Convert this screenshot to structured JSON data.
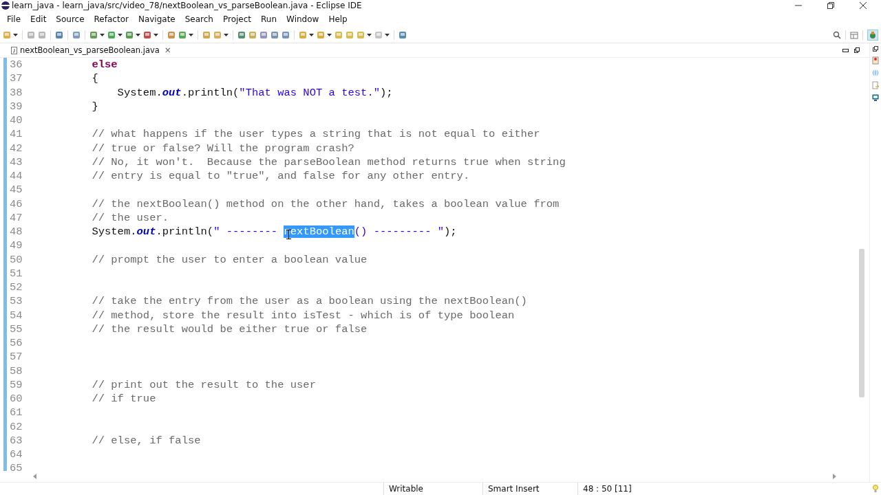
{
  "window": {
    "title": "learn_java - learn_java/src/video_78/nextBoolean_vs_parseBoolean.java - Eclipse IDE"
  },
  "menu": [
    "File",
    "Edit",
    "Source",
    "Refactor",
    "Navigate",
    "Search",
    "Project",
    "Run",
    "Window",
    "Help"
  ],
  "editor_tab": {
    "label": "nextBoolean_vs_parseBoolean.java",
    "close": "×"
  },
  "lines": [
    {
      "num": "36",
      "tokens": [
        {
          "kind": "keyword",
          "text": "        else"
        }
      ]
    },
    {
      "num": "37",
      "tokens": [
        {
          "kind": "plain",
          "text": "        {"
        }
      ]
    },
    {
      "num": "38",
      "tokens": [
        {
          "kind": "plain",
          "text": "            System."
        },
        {
          "kind": "field",
          "text": "out"
        },
        {
          "kind": "plain",
          "text": ".println("
        },
        {
          "kind": "string",
          "text": "\"That was NOT a test.\""
        },
        {
          "kind": "plain",
          "text": ");"
        }
      ]
    },
    {
      "num": "39",
      "tokens": [
        {
          "kind": "plain",
          "text": "        }"
        }
      ]
    },
    {
      "num": "40"
    },
    {
      "num": "41",
      "tokens": [
        {
          "kind": "comment",
          "text": "        // what happens if the user types a string that is not equal to either"
        }
      ]
    },
    {
      "num": "42",
      "tokens": [
        {
          "kind": "comment",
          "text": "        // true or false? Will the program crash?"
        }
      ]
    },
    {
      "num": "43",
      "tokens": [
        {
          "kind": "comment",
          "text": "        // No, it won't.  Because the parseBoolean method returns true when string"
        }
      ]
    },
    {
      "num": "44",
      "tokens": [
        {
          "kind": "comment",
          "text": "        // entry is equal to \"true\", and false for any other entry."
        }
      ]
    },
    {
      "num": "45"
    },
    {
      "num": "46",
      "tokens": [
        {
          "kind": "comment",
          "text": "        // the nextBoolean() method on the other hand, takes a boolean value from"
        }
      ]
    },
    {
      "num": "47",
      "tokens": [
        {
          "kind": "comment",
          "text": "        // the user."
        }
      ]
    },
    {
      "num": "48",
      "tokens": [
        {
          "kind": "plain",
          "text": "        System."
        },
        {
          "kind": "field",
          "text": "out"
        },
        {
          "kind": "plain",
          "text": ".println("
        },
        {
          "kind": "string",
          "text": "\" -------- "
        },
        {
          "kind": "selected",
          "text": "nextBoolean"
        },
        {
          "kind": "string",
          "text": "() --------- \""
        },
        {
          "kind": "plain",
          "text": ");"
        }
      ]
    },
    {
      "num": "49"
    },
    {
      "num": "50",
      "tokens": [
        {
          "kind": "comment",
          "text": "        // prompt the user to enter a boolean value"
        }
      ]
    },
    {
      "num": "51"
    },
    {
      "num": "52"
    },
    {
      "num": "53",
      "tokens": [
        {
          "kind": "comment",
          "text": "        // take the entry from the user as a boolean using the nextBoolean()"
        }
      ]
    },
    {
      "num": "54",
      "tokens": [
        {
          "kind": "comment",
          "text": "        // method, store the result into isTest - which is of type boolean"
        }
      ]
    },
    {
      "num": "55",
      "tokens": [
        {
          "kind": "comment",
          "text": "        // the result would be either true or false"
        }
      ]
    },
    {
      "num": "56"
    },
    {
      "num": "57"
    },
    {
      "num": "58"
    },
    {
      "num": "59",
      "tokens": [
        {
          "kind": "comment",
          "text": "        // print out the result to the user"
        }
      ]
    },
    {
      "num": "60",
      "tokens": [
        {
          "kind": "comment",
          "text": "        // if true"
        }
      ]
    },
    {
      "num": "61"
    },
    {
      "num": "62"
    },
    {
      "num": "63",
      "tokens": [
        {
          "kind": "comment",
          "text": "        // else, if false"
        }
      ]
    },
    {
      "num": "64"
    },
    {
      "num": "65"
    }
  ],
  "status_bar": {
    "mode": "Writable",
    "insert": "Smart Insert",
    "position": "48 : 50 [11]"
  }
}
